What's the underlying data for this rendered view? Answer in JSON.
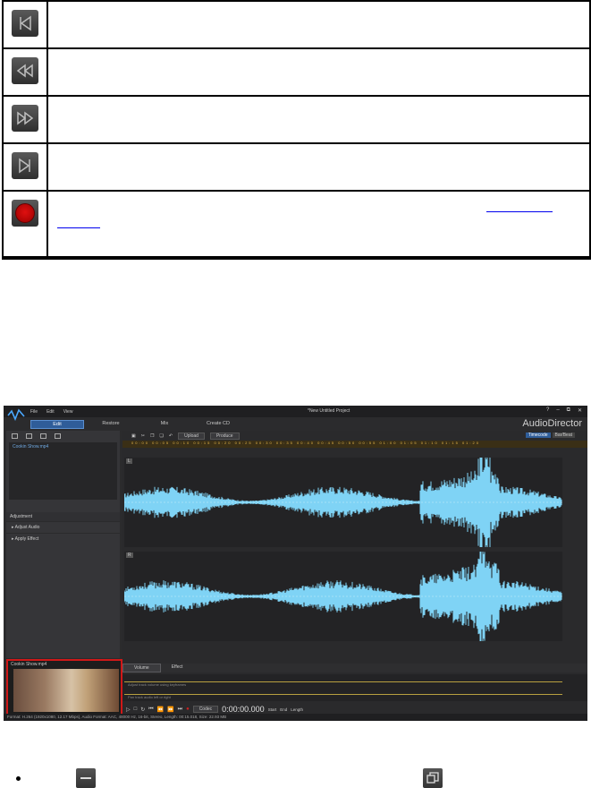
{
  "controls_table": {
    "rows": [
      {
        "icon": "skip-to-start-icon",
        "description": ""
      },
      {
        "icon": "rewind-icon",
        "description": ""
      },
      {
        "icon": "fast-forward-icon",
        "description": ""
      },
      {
        "icon": "skip-to-end-icon",
        "description": ""
      },
      {
        "icon": "record-icon",
        "description": ""
      }
    ]
  },
  "app": {
    "menu": [
      "File",
      "Edit",
      "View"
    ],
    "title": "*New Untitled Project",
    "brand": "AudioDirector",
    "window_buttons": [
      "?",
      "–",
      "⧉",
      "✕"
    ],
    "mode_tabs": [
      "Edit",
      "Restore",
      "Mix",
      "Create CD"
    ],
    "active_tab": "Edit",
    "media_item": "Cookin Show.mp4",
    "adjustment_header": "Adjustment",
    "adjustment_items": [
      "Adjust Audio",
      "Apply Effect"
    ],
    "toolbar": {
      "upload": "Upload",
      "produce": "Produce"
    },
    "time_modes": [
      "Timecode",
      "Bar/Beat"
    ],
    "active_time_mode": "Timecode",
    "ruler_labels": "00:00  00:05  00:10  00:15  00:20  00:25  00:30  00:35  00:40  00:45  00:50  00:55  01:00  01:05  01:10  01:15  01:20",
    "channel_labels": [
      "L",
      "R"
    ],
    "lower_tabs": [
      "Volume",
      "Effect"
    ],
    "active_lower_tab": "Volume",
    "lane_labels": [
      "Adjust track volume using keyframes",
      "Pan track audio left or right"
    ],
    "transport": {
      "codec": "Codec",
      "timecode": "0:00:00.000"
    },
    "range": {
      "start_label": "Start",
      "end_label": "End",
      "length_label": "Length",
      "start": "0:00:00.000",
      "end": "0:00:00.000",
      "length": "0:00:00.000"
    },
    "preview_name": "Cookin Show.mp4",
    "status_bar": "Format: H.264 (1920x1080, 12.17 Mbps), Audio Format: AAC, 48000 Hz, 16-bit, Stereo, Length: 00:15.018, Size: 22.93 MB"
  },
  "bottom_line": {
    "icons": [
      "minimize-icon",
      "restore-window-icon"
    ]
  }
}
